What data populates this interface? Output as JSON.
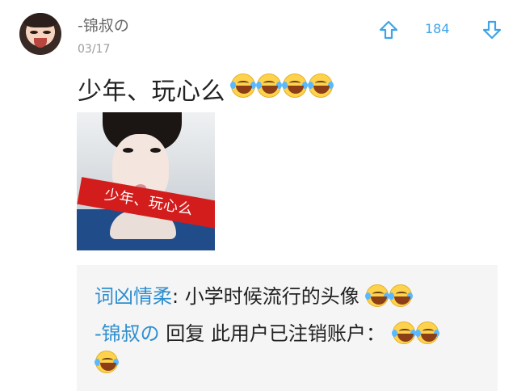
{
  "post": {
    "username": "-锦叔の",
    "date": "03/17",
    "score": "184",
    "text": "少年、玩心么",
    "image_caption": "少年、玩心么",
    "emoji_count": 4
  },
  "comments": {
    "line1_user": "词凶情柔",
    "line1_sep": ":",
    "line1_text": " 小学时候流行的头像",
    "line2_user": "-锦叔の",
    "line2_reply": " 回复 ",
    "line2_target": "此用户已注销账户",
    "line2_sep": "："
  },
  "icons": {
    "upvote": "up-arrow-icon",
    "downvote": "down-arrow-icon",
    "laugh": "laughing-crying-emoji"
  },
  "colors": {
    "accent": "#3ea4e8",
    "banner": "#d31d1d",
    "comment_bg": "#f5f5f5"
  }
}
